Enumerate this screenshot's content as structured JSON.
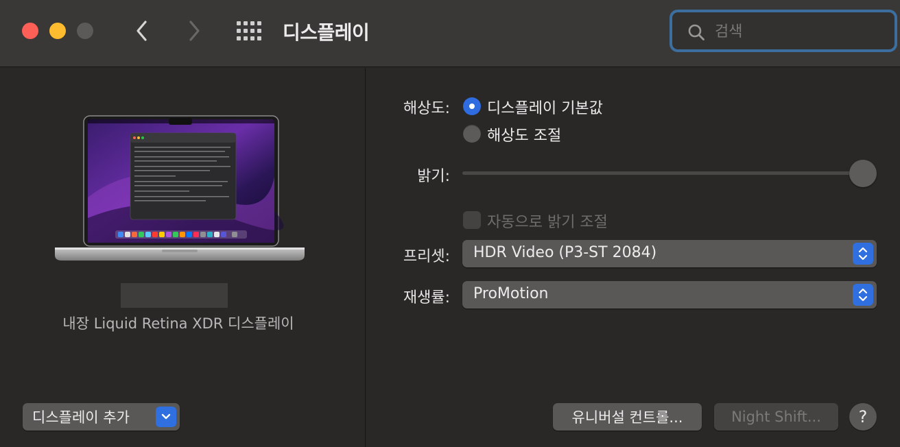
{
  "window": {
    "title": "디스플레이",
    "search_placeholder": "검색"
  },
  "display_panel": {
    "caption": "내장 Liquid Retina XDR 디스플레이",
    "add_display_label": "디스플레이 추가"
  },
  "settings": {
    "resolution_label": "해상도:",
    "resolution_options": [
      "디스플레이 기본값",
      "해상도 조절"
    ],
    "resolution_selected": 0,
    "brightness_label": "밝기:",
    "brightness_level": 1.0,
    "auto_brightness_label": "자동으로 밝기 조절",
    "auto_brightness_checked": false,
    "preset_label": "프리셋:",
    "preset_value": "HDR Video (P3-ST 2084)",
    "refresh_label": "재생률:",
    "refresh_value": "ProMotion"
  },
  "footer": {
    "universal_control_label": "유니버설 컨트롤...",
    "night_shift_label": "Night Shift...",
    "help_label": "?"
  },
  "colors": {
    "accent": "#2f6fe0",
    "search_focus_ring": "#3c6f9f"
  }
}
